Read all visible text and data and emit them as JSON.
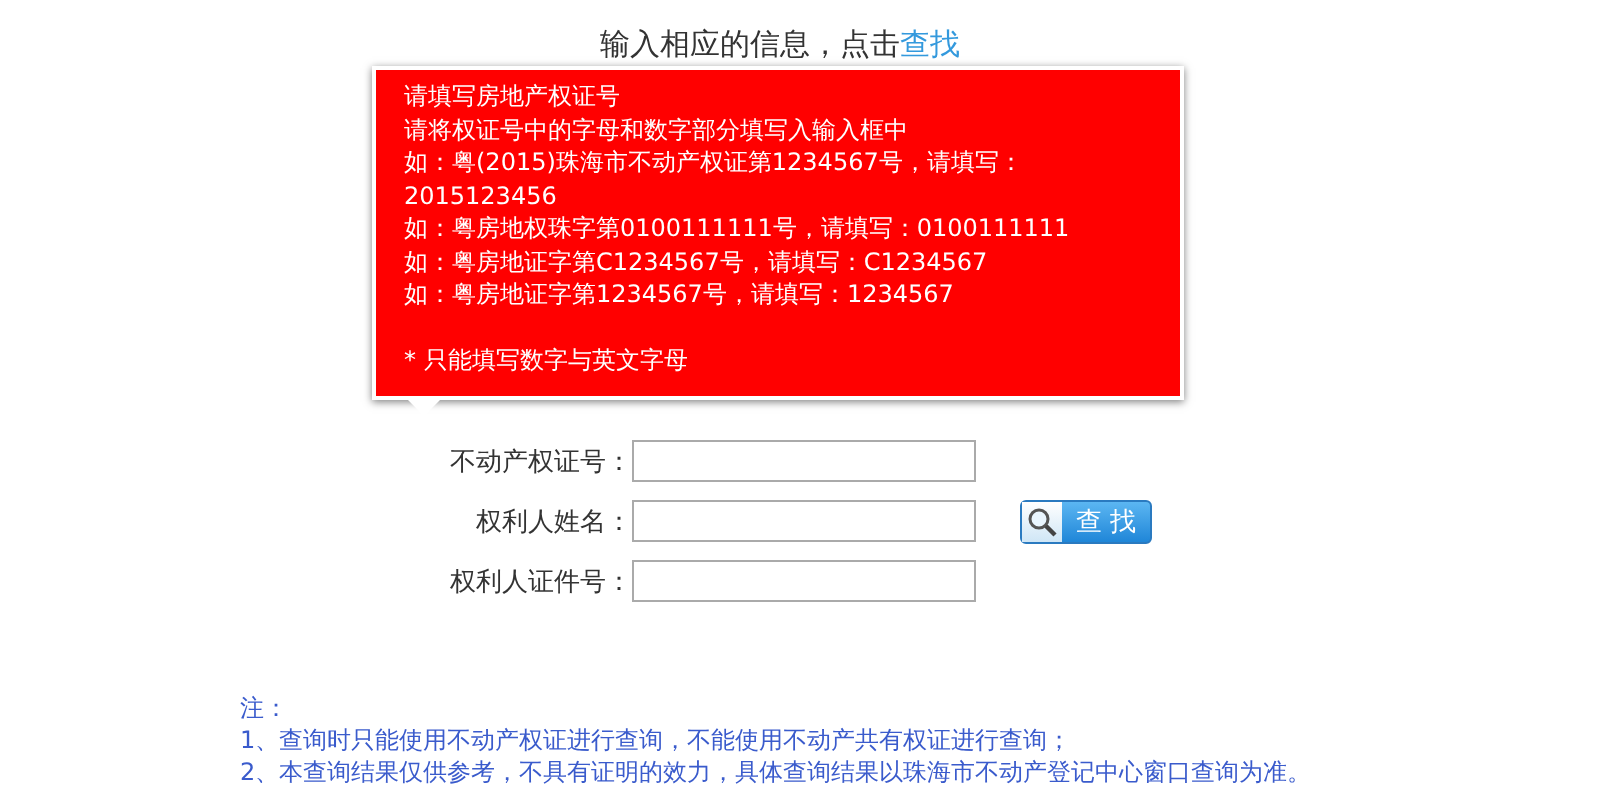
{
  "heading": {
    "text": "输入相应的信息，点击",
    "link": "查找"
  },
  "tooltip": {
    "lines": [
      "请填写房地产权证号",
      "请将权证号中的字母和数字部分填写入输入框中",
      "如：粤(2015)珠海市不动产权证第1234567号，请填写：2015123456",
      "如：粤房地权珠字第0100111111号，请填写：0100111111",
      "如：粤房地证字第C1234567号，请填写：C1234567",
      "如：粤房地证字第1234567号，请填写：1234567"
    ],
    "note": "* 只能填写数字与英文字母"
  },
  "fields": [
    {
      "label": "不动产权证号："
    },
    {
      "label": "权利人姓名："
    },
    {
      "label": "权利人证件号："
    }
  ],
  "search_button": "查 找",
  "notes": [
    "注：",
    "1、查询时只能使用不动产权证进行查询，不能使用不动产共有权证进行查询；",
    "2、本查询结果仅供参考，不具有证明的效力，具体查询结果以珠海市不动产登记中心窗口查询为准。"
  ]
}
